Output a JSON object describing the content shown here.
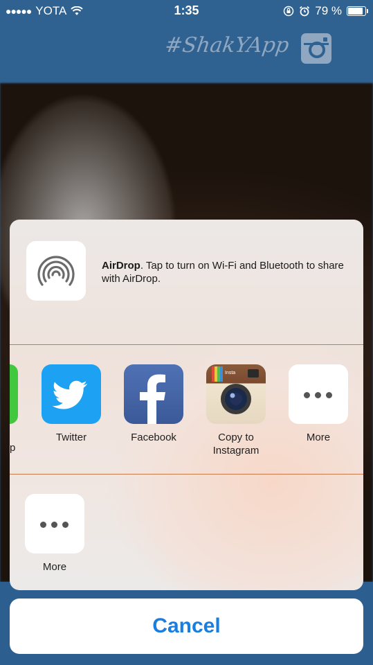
{
  "status_bar": {
    "carrier": "YOTA",
    "time": "1:35",
    "battery_percent": "79 %",
    "battery_level": 0.79
  },
  "header": {
    "app_title": "#ShakYApp",
    "icon": "instagram-icon"
  },
  "share_sheet": {
    "airdrop": {
      "title": "AirDrop",
      "description": ". Tap to turn on Wi-Fi and Bluetooth to share with AirDrop.",
      "icon": "airdrop-icon"
    },
    "partial_label": "p",
    "apps": [
      {
        "label": "Twitter",
        "icon": "twitter-icon"
      },
      {
        "label": "Facebook",
        "icon": "facebook-icon"
      },
      {
        "label": "Copy to\nInstagram",
        "icon": "instagram-camera-icon"
      },
      {
        "label": "More",
        "icon": "more-dots-icon"
      }
    ],
    "actions": [
      {
        "label": "More",
        "icon": "more-dots-icon"
      }
    ]
  },
  "cancel_label": "Cancel",
  "colors": {
    "header_bg": "#2f6290",
    "accent": "#1a7de0",
    "twitter": "#1da1f2",
    "facebook": "#3b5998"
  }
}
